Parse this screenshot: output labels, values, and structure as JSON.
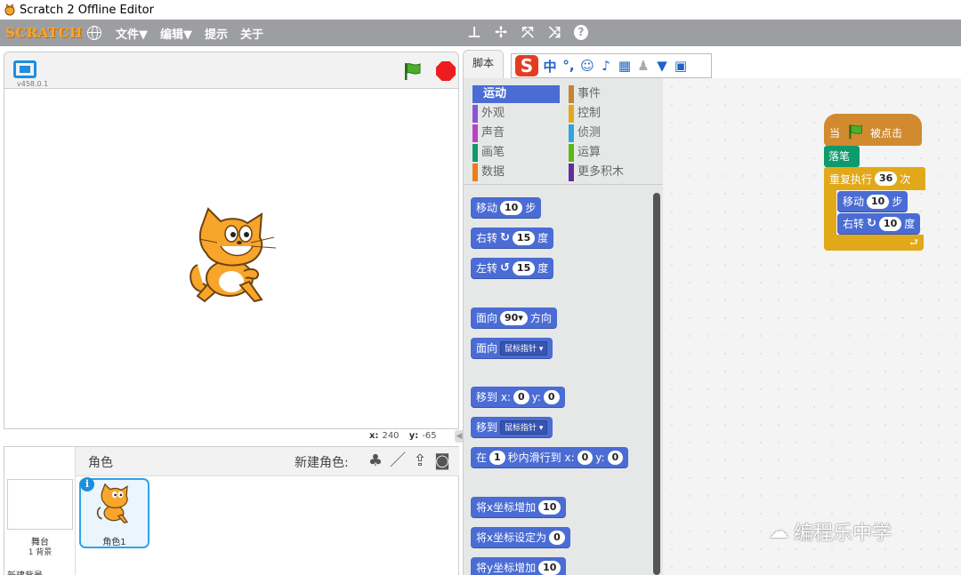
{
  "window": {
    "title": "Scratch 2 Offline Editor"
  },
  "menubar": {
    "logo": "SCRATCH",
    "items": [
      "文件▼",
      "编辑▼",
      "提示",
      "关于"
    ]
  },
  "stage": {
    "version": "v458.0.1",
    "mouse_x_label": "x:",
    "mouse_x": "240",
    "mouse_y_label": "y:",
    "mouse_y": "-65"
  },
  "sprites": {
    "header_label": "角色",
    "new_sprite_label": "新建角色:",
    "stage_label": "舞台",
    "backdrop_count": "1 背景",
    "new_backdrop_label": "新建背景",
    "sprite_name": "角色1"
  },
  "tabs": {
    "scripts": "脚本"
  },
  "categories": [
    {
      "label": "运动",
      "color": "#4a6cd4",
      "selected": true
    },
    {
      "label": "事件",
      "color": "#c88330"
    },
    {
      "label": "外观",
      "color": "#8a55d7"
    },
    {
      "label": "控制",
      "color": "#e1a91a"
    },
    {
      "label": "声音",
      "color": "#bb42c3"
    },
    {
      "label": "侦测",
      "color": "#2ca5e2"
    },
    {
      "label": "画笔",
      "color": "#0e9a6c"
    },
    {
      "label": "运算",
      "color": "#5cb712"
    },
    {
      "label": "数据",
      "color": "#ee7d16"
    },
    {
      "label": "更多积木",
      "color": "#632d99"
    }
  ],
  "palette_blocks": {
    "move": {
      "pre": "移动",
      "num": "10",
      "post": "步"
    },
    "turn_right": {
      "pre": "右转",
      "num": "15",
      "post": "度"
    },
    "turn_left": {
      "pre": "左转",
      "num": "15",
      "post": "度"
    },
    "point_dir": {
      "pre": "面向",
      "num": "90▾",
      "post": "方向"
    },
    "point_towards": {
      "pre": "面向",
      "dropdown": "鼠标指针 ▾"
    },
    "goto_xy": {
      "pre": "移到 x:",
      "x": "0",
      "mid": "y:",
      "y": "0"
    },
    "goto": {
      "pre": "移到",
      "dropdown": "鼠标指针 ▾"
    },
    "glide": {
      "pre": "在",
      "secs": "1",
      "mid1": "秒内滑行到 x:",
      "x": "0",
      "mid2": "y:",
      "y": "0"
    },
    "change_x": {
      "pre": "将x坐标增加",
      "num": "10"
    },
    "set_x": {
      "pre": "将x坐标设定为",
      "num": "0"
    },
    "change_y": {
      "pre": "将y坐标增加",
      "num": "10"
    }
  },
  "script": {
    "when_flag": {
      "pre": "当",
      "post": "被点击"
    },
    "pen_down": "落笔",
    "repeat": {
      "pre": "重复执行",
      "num": "36",
      "post": "次"
    },
    "move": {
      "pre": "移动",
      "num": "10",
      "post": "步"
    },
    "turn": {
      "pre": "右转",
      "num": "10",
      "post": "度"
    }
  },
  "watermark": {
    "text": "编程乐中学"
  }
}
